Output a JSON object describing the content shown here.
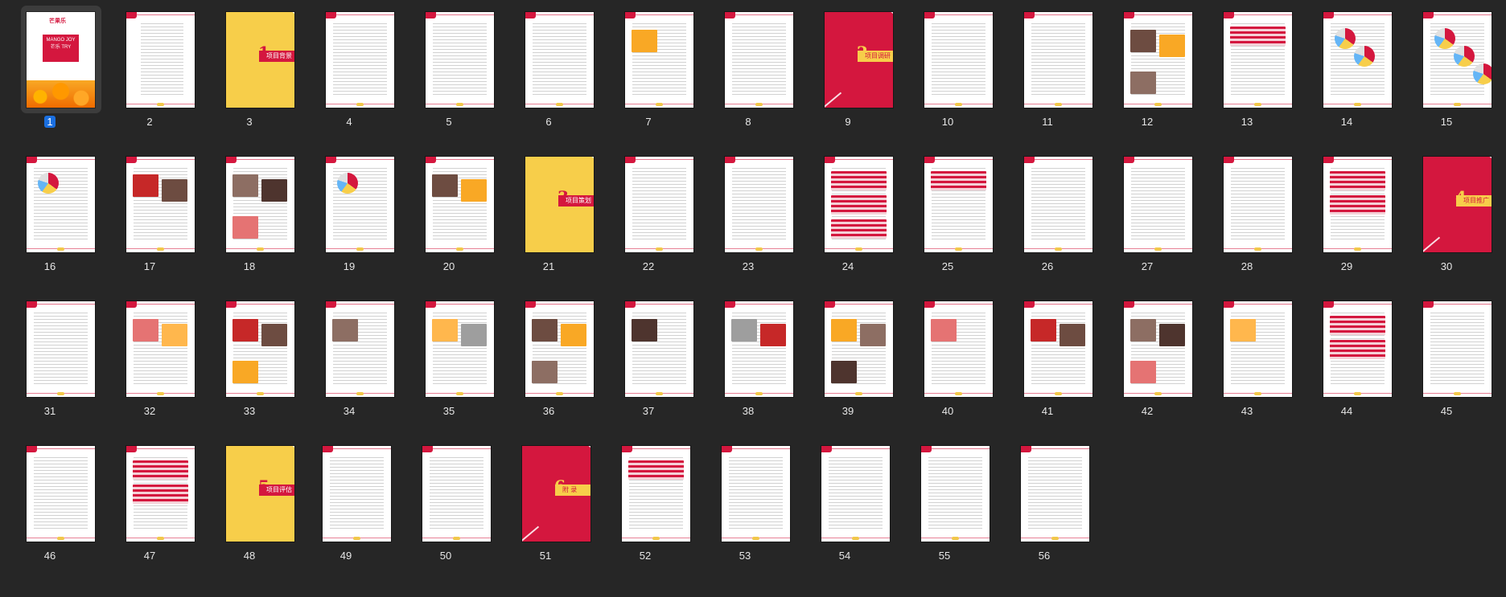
{
  "app": {
    "name": "Document page thumbnails",
    "selected_page": "1"
  },
  "colors": {
    "background": "#262626",
    "accent_red": "#d4173e",
    "accent_yellow": "#f7ce4a",
    "selection_badge": "#1a6fe0"
  },
  "cover": {
    "logo_text": "芒果乐",
    "title_en": "MANGO JOY",
    "title_cn": "芒乐 TRY"
  },
  "sections": [
    {
      "page": "3",
      "number": "1",
      "title": "项目背景"
    },
    {
      "page": "9",
      "number": "2",
      "title": "项目调研"
    },
    {
      "page": "21",
      "number": "3",
      "title": "项目策划"
    },
    {
      "page": "30",
      "number": "4",
      "title": "项目推广"
    },
    {
      "page": "48",
      "number": "5",
      "title": "项目评估"
    },
    {
      "page": "51",
      "number": "6",
      "title": "附 录"
    }
  ],
  "pages": [
    {
      "label": "1",
      "kind": "cover"
    },
    {
      "label": "2",
      "kind": "toc"
    },
    {
      "label": "3",
      "kind": "section-yellow",
      "section": 0
    },
    {
      "label": "4",
      "kind": "text"
    },
    {
      "label": "5",
      "kind": "text"
    },
    {
      "label": "6",
      "kind": "text"
    },
    {
      "label": "7",
      "kind": "image"
    },
    {
      "label": "8",
      "kind": "text"
    },
    {
      "label": "9",
      "kind": "section-red",
      "section": 1
    },
    {
      "label": "10",
      "kind": "text"
    },
    {
      "label": "11",
      "kind": "text"
    },
    {
      "label": "12",
      "kind": "image"
    },
    {
      "label": "13",
      "kind": "table"
    },
    {
      "label": "14",
      "kind": "chart"
    },
    {
      "label": "15",
      "kind": "chart"
    },
    {
      "label": "16",
      "kind": "chart"
    },
    {
      "label": "17",
      "kind": "image"
    },
    {
      "label": "18",
      "kind": "image"
    },
    {
      "label": "19",
      "kind": "chart"
    },
    {
      "label": "20",
      "kind": "image"
    },
    {
      "label": "21",
      "kind": "section-yellow",
      "section": 2
    },
    {
      "label": "22",
      "kind": "text"
    },
    {
      "label": "23",
      "kind": "text"
    },
    {
      "label": "24",
      "kind": "table"
    },
    {
      "label": "25",
      "kind": "table"
    },
    {
      "label": "26",
      "kind": "text"
    },
    {
      "label": "27",
      "kind": "text"
    },
    {
      "label": "28",
      "kind": "text"
    },
    {
      "label": "29",
      "kind": "table"
    },
    {
      "label": "30",
      "kind": "section-red",
      "section": 3
    },
    {
      "label": "31",
      "kind": "text"
    },
    {
      "label": "32",
      "kind": "image"
    },
    {
      "label": "33",
      "kind": "image"
    },
    {
      "label": "34",
      "kind": "image"
    },
    {
      "label": "35",
      "kind": "image"
    },
    {
      "label": "36",
      "kind": "image"
    },
    {
      "label": "37",
      "kind": "image"
    },
    {
      "label": "38",
      "kind": "image"
    },
    {
      "label": "39",
      "kind": "image"
    },
    {
      "label": "40",
      "kind": "image"
    },
    {
      "label": "41",
      "kind": "image"
    },
    {
      "label": "42",
      "kind": "image"
    },
    {
      "label": "43",
      "kind": "image"
    },
    {
      "label": "44",
      "kind": "table"
    },
    {
      "label": "45",
      "kind": "text"
    },
    {
      "label": "46",
      "kind": "text"
    },
    {
      "label": "47",
      "kind": "table"
    },
    {
      "label": "48",
      "kind": "section-yellow",
      "section": 4
    },
    {
      "label": "49",
      "kind": "text"
    },
    {
      "label": "50",
      "kind": "text"
    },
    {
      "label": "51",
      "kind": "section-red",
      "section": 5
    },
    {
      "label": "52",
      "kind": "table"
    },
    {
      "label": "53",
      "kind": "text"
    },
    {
      "label": "54",
      "kind": "text"
    },
    {
      "label": "55",
      "kind": "text"
    },
    {
      "label": "56",
      "kind": "text"
    }
  ]
}
